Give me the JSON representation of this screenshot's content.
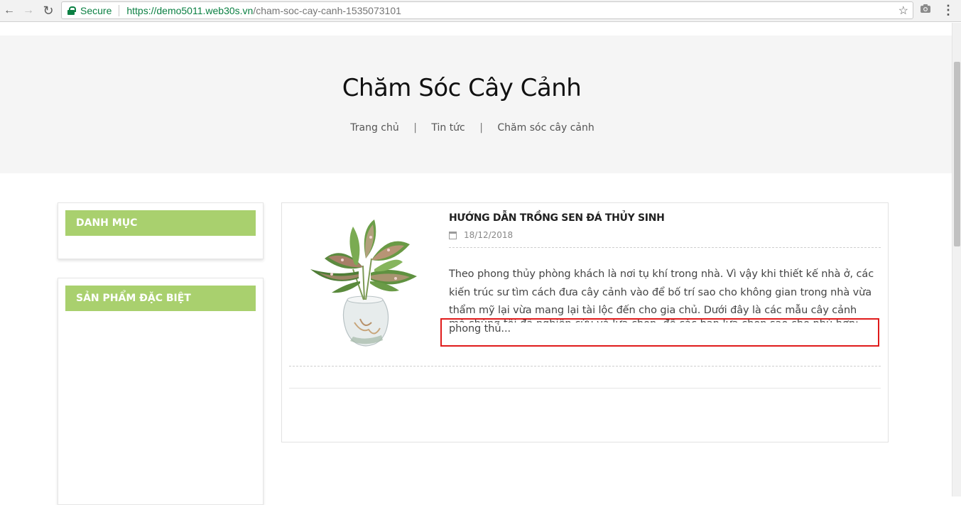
{
  "browser": {
    "back_glyph": "←",
    "forward_glyph": "→",
    "reload_glyph": "↻",
    "secure_label": "Secure",
    "url_host": "https://demo5011.web30s.vn",
    "url_path": "/cham-soc-cay-canh-1535073101",
    "star_glyph": "☆",
    "menu_glyph": "⋮"
  },
  "hero": {
    "title": "Chăm Sóc Cây Cảnh",
    "breadcrumb": [
      {
        "label": "Trang chủ"
      },
      {
        "label": "Tin tức"
      },
      {
        "label": "Chăm sóc cây cảnh"
      }
    ],
    "separator": "|"
  },
  "sidebar": {
    "category_title": "DANH MỤC",
    "special_title": "SẢN PHẨM ĐẶC BIỆT"
  },
  "post": {
    "title": "HƯỚNG DẪN TRỒNG SEN ĐÁ THỦY SINH",
    "date": "18/12/2018",
    "excerpt": "Theo phong thủy phòng khách là nơi tụ khí trong nhà. Vì vậy khi thiết kế nhà ở, các kiến trúc sư tìm cách đưa cây cảnh vào để bố trí sao cho không gian trong nhà vừa thẩm mỹ lại vừa mang lại tài lộc đến cho gia chủ. Dưới đây là các mẫu cây cảnh phong thủ...",
    "excerpt_overflow": "mà chúng tôi đã nghiên cứu và lựa chọn, để các bạn lựa chọn sao cho phù hợp:"
  },
  "colors": {
    "accent_green": "#a9d06e",
    "secure_green": "#0b8043",
    "highlight_red": "#e01b1b"
  }
}
